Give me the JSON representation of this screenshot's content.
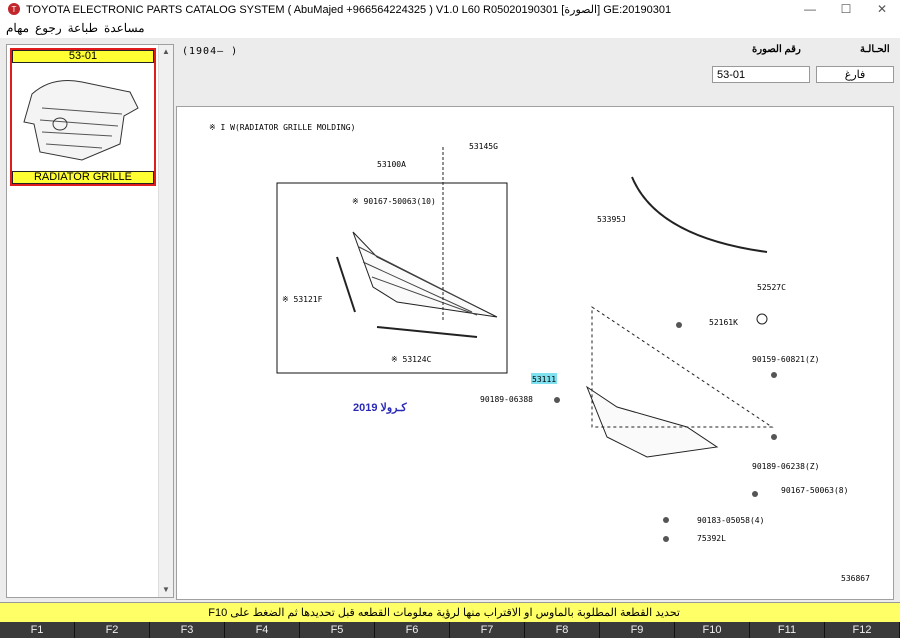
{
  "window": {
    "title": "TOYOTA ELECTRONIC PARTS CATALOG SYSTEM ( AbuMajed +966564224325 ) V1.0 L60 R05020190301 [الصورة] GE:20190301",
    "minimize": "—",
    "maximize": "☐",
    "close": "✕"
  },
  "menu": [
    "مهام",
    "رجوع",
    "طباعة",
    "مساعدة"
  ],
  "thumbnail": {
    "code": "53-01",
    "caption": "RADIATOR GRILLE"
  },
  "top": {
    "range": "(1904–          )",
    "status_label": "الحـالـة",
    "image_no_label": "رقم الصورة",
    "image_no_value": "53-01",
    "status_value": "فارغ"
  },
  "diagram": {
    "note": "※ I W(RADIATOR GRILLE MOLDING)",
    "annotation": "كـرولا 2019",
    "figure_no": "536867",
    "parts": [
      {
        "code": "53145G"
      },
      {
        "code": "53100A"
      },
      {
        "code": "※ 90167-50063(10)"
      },
      {
        "code": "※ 53121F"
      },
      {
        "code": "※ 53124C"
      },
      {
        "code": "53395J"
      },
      {
        "code": "52527C"
      },
      {
        "code": "52161K"
      },
      {
        "code": "90159-60821(Z)"
      },
      {
        "code": "53111"
      },
      {
        "code": "90189-06388"
      },
      {
        "code": "90189-06238(Z)"
      },
      {
        "code": "90167-50063(8)"
      },
      {
        "code": "90183-05058(4)"
      },
      {
        "code": "75392L"
      }
    ]
  },
  "statusbar": "تحديد القطعة المطلوبة بالماوس او الاقتراب منها لرؤية معلومات القطعه قبل تحديدها ثم الضغط على F10",
  "fkeys": [
    "F1",
    "F2",
    "F3",
    "F4",
    "F5",
    "F6",
    "F7",
    "F8",
    "F9",
    "F10",
    "F11",
    "F12"
  ]
}
